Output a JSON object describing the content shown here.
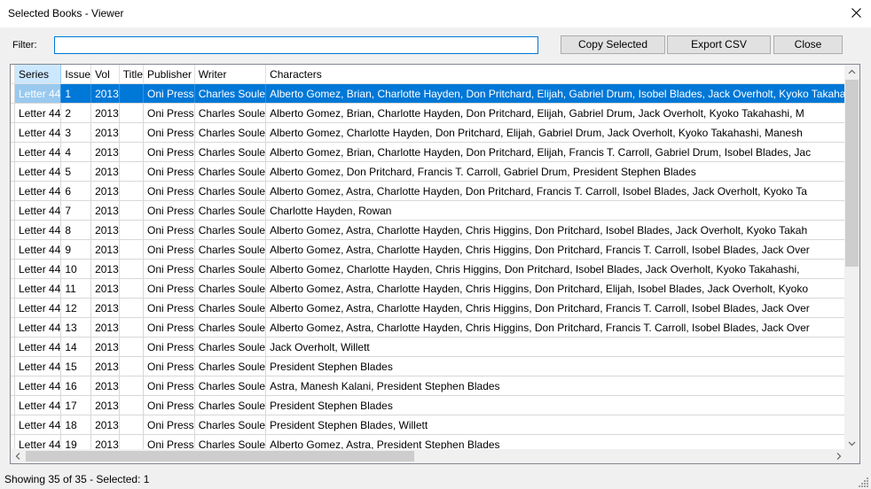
{
  "window": {
    "title": "Selected Books - Viewer"
  },
  "filter": {
    "label": "Filter:",
    "value": ""
  },
  "toolbar": {
    "copy_label": "Copy Selected",
    "export_label": "Export CSV",
    "close_label": "Close"
  },
  "grid": {
    "columns": [
      "Series",
      "Issue",
      "Vol",
      "Title",
      "Publisher",
      "Writer",
      "Characters"
    ],
    "selected_row": 0,
    "rows": [
      [
        "Letter 44",
        "1",
        "2013",
        "",
        "Oni Press",
        "Charles Soule",
        "Alberto Gomez, Brian, Charlotte Hayden, Don Pritchard, Elijah, Gabriel Drum, Isobel Blades, Jack Overholt, Kyoko Takahashi"
      ],
      [
        "Letter 44",
        "2",
        "2013",
        "",
        "Oni Press",
        "Charles Soule",
        "Alberto Gomez, Brian, Charlotte Hayden, Don Pritchard, Elijah, Gabriel Drum, Jack Overholt, Kyoko Takahashi, M"
      ],
      [
        "Letter 44",
        "3",
        "2013",
        "",
        "Oni Press",
        "Charles Soule",
        "Alberto Gomez, Charlotte Hayden, Don Pritchard, Elijah, Gabriel Drum, Jack Overholt, Kyoko Takahashi, Manesh"
      ],
      [
        "Letter 44",
        "4",
        "2013",
        "",
        "Oni Press",
        "Charles Soule",
        "Alberto Gomez, Brian, Charlotte Hayden, Don Pritchard, Elijah, Francis T. Carroll, Gabriel Drum, Isobel Blades, Jac"
      ],
      [
        "Letter 44",
        "5",
        "2013",
        "",
        "Oni Press",
        "Charles Soule",
        "Alberto Gomez, Don Pritchard, Francis T. Carroll, Gabriel Drum, President Stephen Blades"
      ],
      [
        "Letter 44",
        "6",
        "2013",
        "",
        "Oni Press",
        "Charles Soule",
        "Alberto Gomez, Astra, Charlotte Hayden, Don Pritchard, Francis T. Carroll, Isobel Blades, Jack Overholt, Kyoko Ta"
      ],
      [
        "Letter 44",
        "7",
        "2013",
        "",
        "Oni Press",
        "Charles Soule",
        "Charlotte Hayden, Rowan"
      ],
      [
        "Letter 44",
        "8",
        "2013",
        "",
        "Oni Press",
        "Charles Soule",
        "Alberto Gomez, Astra, Charlotte Hayden, Chris Higgins, Don Pritchard, Isobel Blades, Jack Overholt, Kyoko Takah"
      ],
      [
        "Letter 44",
        "9",
        "2013",
        "",
        "Oni Press",
        "Charles Soule",
        "Alberto Gomez, Astra, Charlotte Hayden, Chris Higgins, Don Pritchard, Francis T. Carroll, Isobel Blades, Jack Over"
      ],
      [
        "Letter 44",
        "10",
        "2013",
        "",
        "Oni Press",
        "Charles Soule",
        "Alberto Gomez, Charlotte Hayden, Chris Higgins, Don Pritchard, Isobel Blades, Jack Overholt, Kyoko Takahashi,"
      ],
      [
        "Letter 44",
        "11",
        "2013",
        "",
        "Oni Press",
        "Charles Soule",
        "Alberto Gomez, Astra, Charlotte Hayden, Chris Higgins, Don Pritchard, Elijah, Isobel Blades, Jack Overholt, Kyoko"
      ],
      [
        "Letter 44",
        "12",
        "2013",
        "",
        "Oni Press",
        "Charles Soule",
        "Alberto Gomez, Astra, Charlotte Hayden, Chris Higgins, Don Pritchard, Francis T. Carroll, Isobel Blades, Jack Over"
      ],
      [
        "Letter 44",
        "13",
        "2013",
        "",
        "Oni Press",
        "Charles Soule",
        "Alberto Gomez, Astra, Charlotte Hayden, Chris Higgins, Don Pritchard, Francis T. Carroll, Isobel Blades, Jack Over"
      ],
      [
        "Letter 44",
        "14",
        "2013",
        "",
        "Oni Press",
        "Charles Soule",
        "Jack Overholt, Willett"
      ],
      [
        "Letter 44",
        "15",
        "2013",
        "",
        "Oni Press",
        "Charles Soule",
        "President Stephen Blades"
      ],
      [
        "Letter 44",
        "16",
        "2013",
        "",
        "Oni Press",
        "Charles Soule",
        "Astra, Manesh Kalani, President Stephen Blades"
      ],
      [
        "Letter 44",
        "17",
        "2013",
        "",
        "Oni Press",
        "Charles Soule",
        "President Stephen Blades"
      ],
      [
        "Letter 44",
        "18",
        "2013",
        "",
        "Oni Press",
        "Charles Soule",
        "President Stephen Blades, Willett"
      ],
      [
        "Letter 44",
        "19",
        "2013",
        "",
        "Oni Press",
        "Charles Soule",
        "Alberto Gomez, Astra, President Stephen Blades"
      ]
    ]
  },
  "status": {
    "text": "Showing 35 of 35 - Selected: 1"
  },
  "colors": {
    "selection": "#0078d7",
    "focus_border": "#0078d7",
    "header_sorted": "#cce8ff"
  },
  "icons": {
    "close": "close-icon",
    "row_indicator": "current-row-icon",
    "scroll_up": "chevron-up-icon",
    "scroll_down": "chevron-down-icon",
    "scroll_left": "chevron-left-icon",
    "scroll_right": "chevron-right-icon",
    "grip": "resize-grip-icon"
  }
}
